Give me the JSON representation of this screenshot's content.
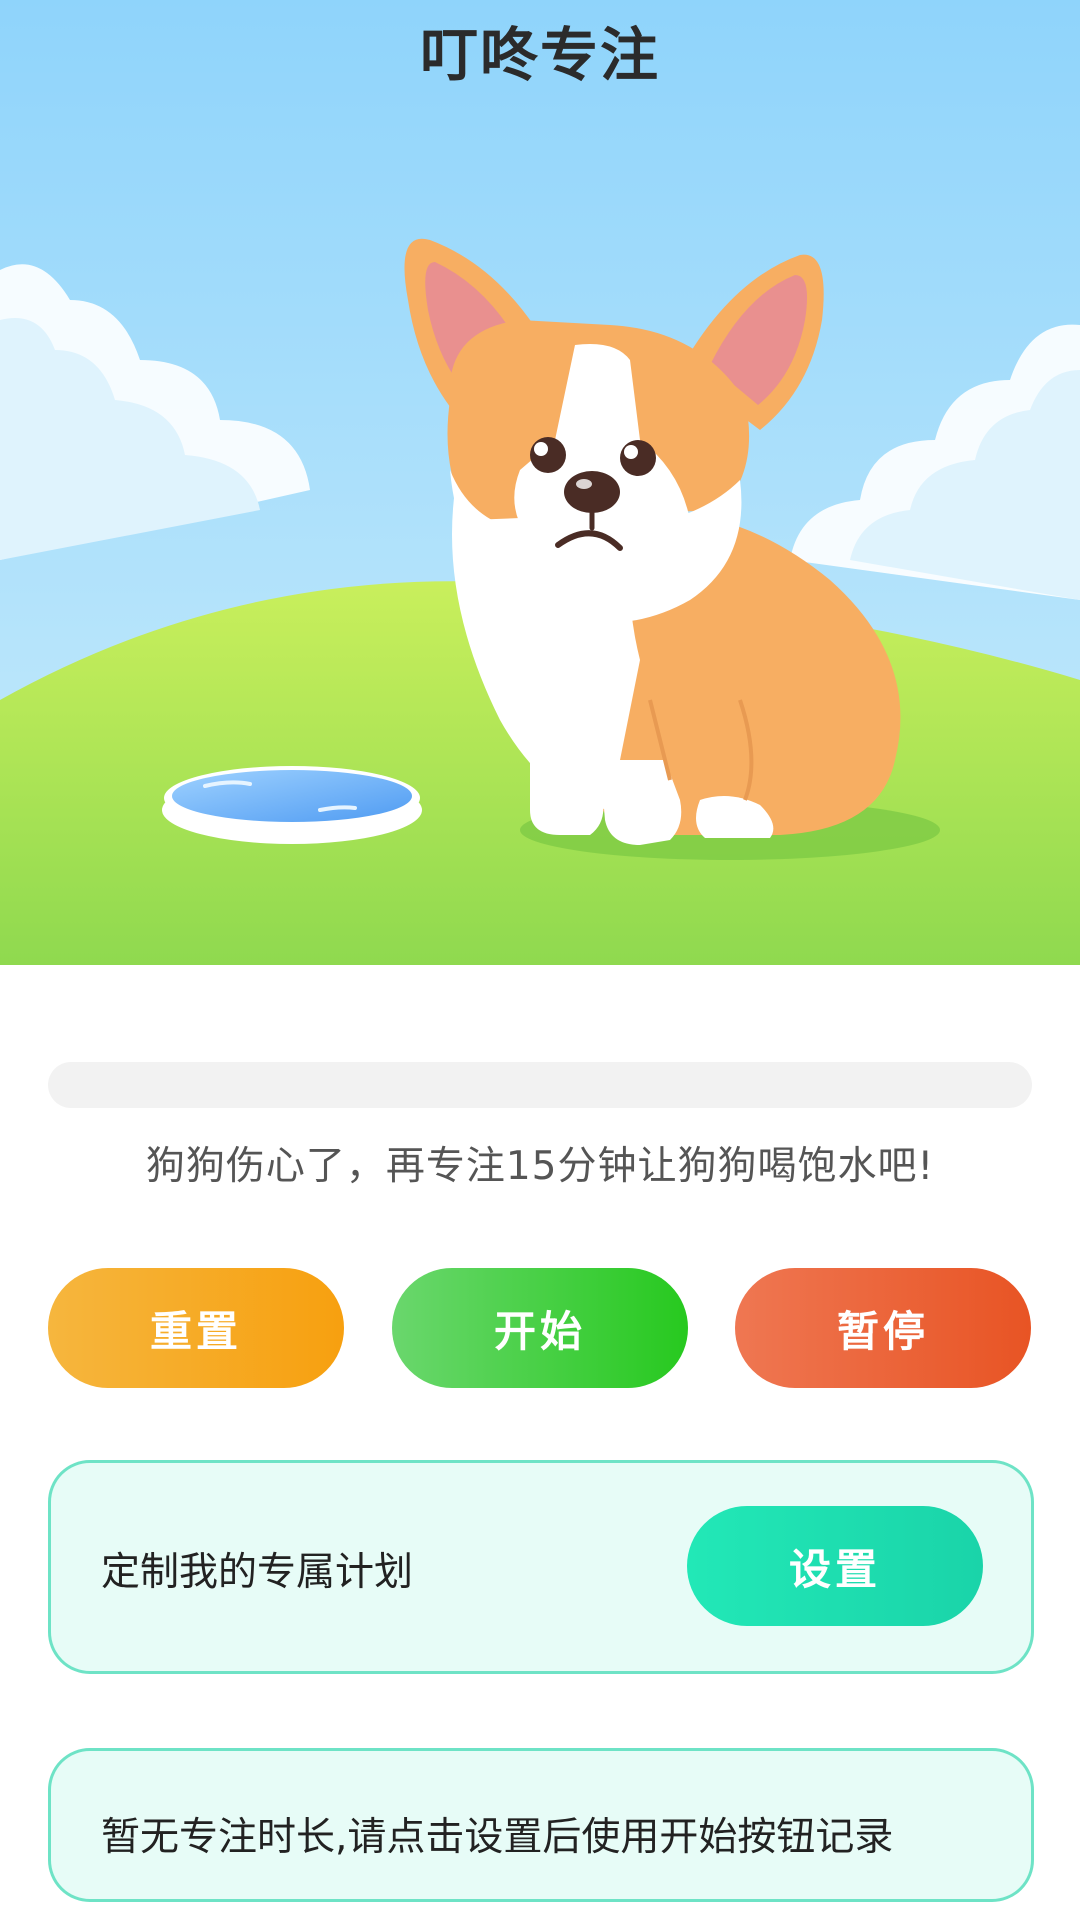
{
  "app": {
    "title": "叮咚专注"
  },
  "progress": {
    "percent": 0
  },
  "status": {
    "message": "狗狗伤心了，再专注15分钟让狗狗喝饱水吧!"
  },
  "controls": {
    "reset_label": "重置",
    "start_label": "开始",
    "pause_label": "暂停"
  },
  "plan_card": {
    "text": "定制我的专属计划",
    "settings_label": "设置"
  },
  "record_card": {
    "text": "暂无专注时长,请点击设置后使用开始按钮记录"
  },
  "colors": {
    "sky": "#8fd4fb",
    "grass": "#9be05b",
    "accent_reset": "#f7a00f",
    "accent_start": "#27c91f",
    "accent_pause": "#e85424",
    "accent_settings": "#1fdcb0",
    "card_border": "#6ee3c6"
  },
  "icons": {
    "hero": "sad-corgi-illustration",
    "water": "water-bowl-illustration"
  }
}
